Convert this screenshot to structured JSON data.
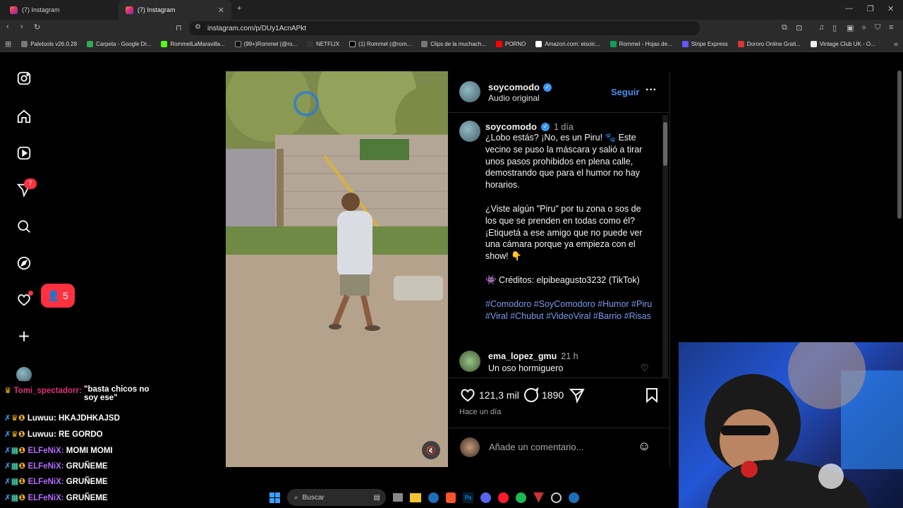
{
  "browser": {
    "tabs": [
      {
        "label": "(7) Instagram"
      },
      {
        "label": "(7) Instagram"
      }
    ],
    "url": "instagram.com/p/DUy1AcnAPkt",
    "bookmarks": [
      "Paletools v26.0.28",
      "Carpeta - Google Dr...",
      "RommelLaMaravilla...",
      "(99+)Rommel (@ro...",
      "NETFLIX",
      "(1) Rommel (@rom...",
      "Clips de la muchach...",
      "PORNO",
      "Amazon.com: eisoic...",
      "Rommel - Hojas de...",
      "Stripe Express",
      "Dororo Online Grati...",
      "Vintage Club UK - O..."
    ]
  },
  "sidebar": {
    "notifications_badge": "7",
    "followers_badge": "5"
  },
  "post": {
    "username": "soycomodo",
    "audio": "Audio original",
    "follow_label": "Seguir",
    "caption_time": "1 día",
    "caption_p1": "¿Lobo estás? ¡No, es un Piru! 🐾 Este vecino se puso la máscara y salió a tirar unos pasos prohibidos en plena calle, demostrando que para el humor no hay horarios.",
    "caption_p2": "¿Viste algún \"Piru\" por tu zona o sos de los que se prenden en todas como él? ¡Etiquetá a ese amigo que no puede ver una cámara porque ya empieza con el show! 👇",
    "credits": "👾 Créditos: elpibeagusto3232 (TikTok)",
    "hashtags": "#Comodoro #SoyComodoro #Humor #Piru #Viral #Chubut #VideoViral #Barrio #Risas",
    "comment": {
      "user": "ema_lopez_gmu",
      "time": "21 h",
      "text": "Un oso hormiguero"
    },
    "likes": "121,3 mil",
    "comments_count": "1890",
    "posted": "Hace un día",
    "add_comment_placeholder": "Añade un comentario..."
  },
  "chat": [
    {
      "user": "Tomi_spectadorr:",
      "msg": "\"basta chicos no soy ese\"",
      "color": "#e0307a"
    },
    {
      "user": "Luwuu:",
      "msg": "HKAJDHKAJSD",
      "color": "#e8e8e8"
    },
    {
      "user": "Luwuu:",
      "msg": "RE GORDO",
      "color": "#e8e8e8"
    },
    {
      "user": "ELFeNiX:",
      "msg": "MOMI MOMI",
      "color": "#b36cff"
    },
    {
      "user": "ELFeNiX:",
      "msg": "GRUÑEME",
      "color": "#b36cff"
    },
    {
      "user": "ELFeNiX:",
      "msg": "GRUÑEME",
      "color": "#b36cff"
    },
    {
      "user": "ELFeNiX:",
      "msg": "GRUÑEME",
      "color": "#b36cff"
    }
  ],
  "taskbar": {
    "search_placeholder": "Buscar"
  },
  "colors": {
    "accent_blue": "#3897f0",
    "hashtag_blue": "#7b9bf0",
    "badge_red": "#ff3040"
  }
}
